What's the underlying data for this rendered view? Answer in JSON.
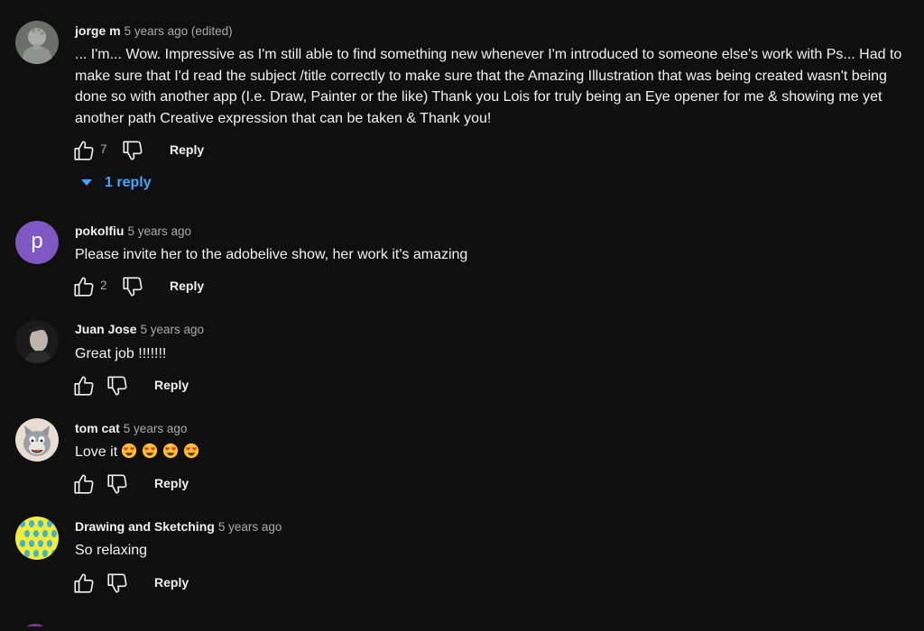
{
  "colors": {
    "background": "#0f0f0f",
    "text": "#f1f1f1",
    "muted": "#aaaaaa",
    "link": "#3ea6ff"
  },
  "icons": {
    "like": "thumb-up-icon",
    "dislike": "thumb-down-icon",
    "caret": "caret-down-icon",
    "emoji": "heart-eyes-emoji"
  },
  "comments": [
    {
      "author": "jorge m",
      "time": "5 years ago (edited)",
      "text": "... I'm... Wow. Impressive as I'm still able to find something new whenever I'm introduced to someone else's work with Ps... Had to make sure that I'd read the subject /title correctly to make sure that the Amazing Illustration that was being created wasn't being done so with another app (I.e. Draw, Painter  or the like)  Thank you Lois for truly being an Eye opener  for me & showing me yet another path Creative expression  that can be taken & Thank you!",
      "likes": "7",
      "reply_label": "Reply",
      "replies_label": "1 reply"
    },
    {
      "author": "pokolfiu",
      "time": "5 years ago",
      "avatar_letter": "p",
      "text": "Please invite her to the adobelive show, her work it's amazing",
      "likes": "2",
      "reply_label": "Reply"
    },
    {
      "author": "Juan Jose",
      "time": "5 years ago",
      "text": "Great job !!!!!!!",
      "reply_label": "Reply"
    },
    {
      "author": "tom cat",
      "time": "5 years ago",
      "text": "Love it",
      "emoji_count": 4,
      "reply_label": "Reply"
    },
    {
      "author": "Drawing and Sketching",
      "time": "5 years ago",
      "text": "So relaxing",
      "reply_label": "Reply"
    }
  ]
}
